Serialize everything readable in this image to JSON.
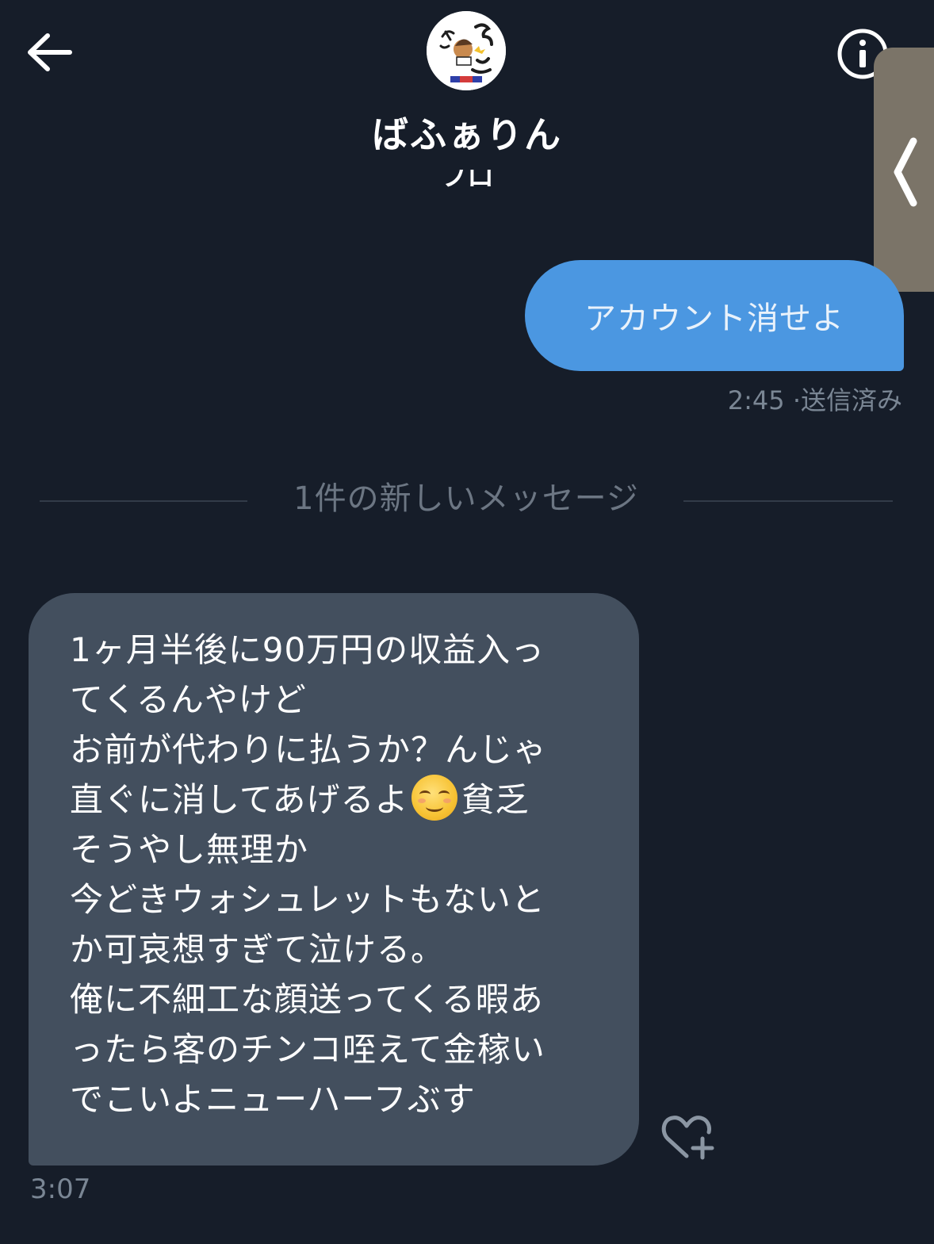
{
  "header": {
    "back_icon": "arrow-left-icon",
    "avatar_icon": "user-avatar",
    "name": "ばふぁりん",
    "subtitle": "フロ",
    "info_icon": "info-icon"
  },
  "side_panel": {
    "icon": "chevron-left-icon"
  },
  "messages": {
    "sent": {
      "text": "アカウント消せよ",
      "time": "2:45",
      "status": "·送信済み"
    },
    "divider": "1件の新しいメッセージ",
    "received": {
      "lines": [
        "1ヶ月半後に90万円の収益入っ",
        "てくるんやけど",
        "お前が代わりに払うか？んじゃ",
        "直ぐに消してあげるよ",
        "貧乏",
        "そうやし無理か",
        "今どきウォシュレットもないと",
        "か可哀想すぎて泣ける。",
        "俺に不細工な顔送ってくる暇あ",
        "ったら客のチンコ咥えて金稼い",
        "でこいよニューハーフぶす"
      ],
      "emoji": "☺️",
      "time": "3:07",
      "like_icon": "heart-plus-icon"
    }
  },
  "colors": {
    "background": "#161d29",
    "sent_bubble": "#4b97e1",
    "received_bubble": "#434f5e",
    "muted_text": "#7a8694"
  }
}
